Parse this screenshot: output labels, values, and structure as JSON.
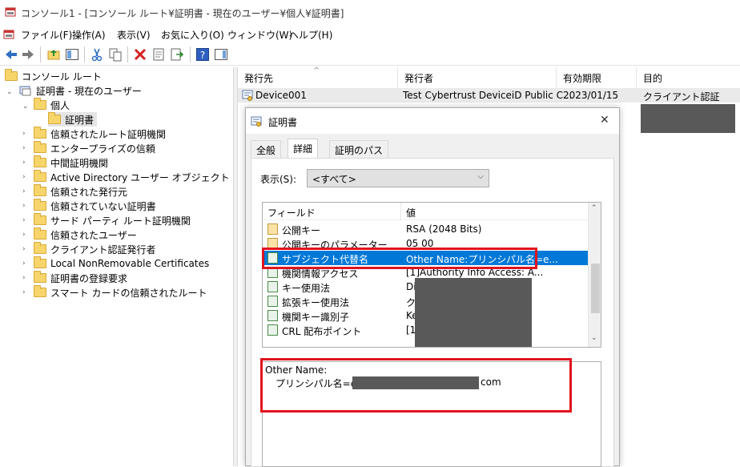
{
  "window": {
    "title": "コンソール1 - [コンソール ルート¥証明書 - 現在のユーザー¥個人¥証明書]"
  },
  "menu": [
    "ファイル(F)",
    "操作(A)",
    "表示(V)",
    "お気に入り(O)",
    "ウィンドウ(W)",
    "ヘルプ(H)"
  ],
  "tree": {
    "root": "コンソール ルート",
    "store": "証明書 - 現在のユーザー",
    "personal": "個人",
    "certs": "証明書",
    "items": [
      "信頼されたルート証明機関",
      "エンタープライズの信頼",
      "中間証明機関",
      "Active Directory ユーザー オブジェクト",
      "信頼された発行元",
      "信頼されていない証明書",
      "サード パーティ ルート証明機関",
      "信頼されたユーザー",
      "クライアント認証発行者",
      "Local NonRemovable Certificates",
      "証明書の登録要求",
      "スマート カードの信頼されたルート"
    ]
  },
  "list": {
    "columns": [
      "発行先",
      "発行者",
      "有効期限",
      "目的"
    ],
    "rows": [
      [
        "Device001",
        "Test Cybertrust DeviceiD Public C...",
        "2023/01/15",
        "クライアント認証"
      ]
    ]
  },
  "dialog": {
    "title": "証明書",
    "close": "✕",
    "tabs": [
      "全般",
      "詳細",
      "証明のパス"
    ],
    "show_label": "表示(S):",
    "show_value": "<すべて>",
    "field_header": "フィールド",
    "value_header": "値",
    "fields": [
      {
        "name": "公開キー",
        "value": "RSA (2048 Bits)"
      },
      {
        "name": "公開キーのパラメーター",
        "value": "05 00"
      },
      {
        "name": "サブジェクト代替名",
        "value": "Other Name:プリンシパル名=e..."
      },
      {
        "name": "機関情報アクセス",
        "value": "[1]Authority Info Access: A..."
      },
      {
        "name": "キー使用法",
        "value": "Di"
      },
      {
        "name": "拡張キー使用法",
        "value": "ク"
      },
      {
        "name": "機関キー識別子",
        "value": "Ke"
      },
      {
        "name": "CRL 配布ポイント",
        "value": "[1"
      }
    ],
    "detail_line1": "Other Name:",
    "detail_line2_prefix": "プリンシパル名=ems",
    "detail_line2_suffix": "com"
  }
}
